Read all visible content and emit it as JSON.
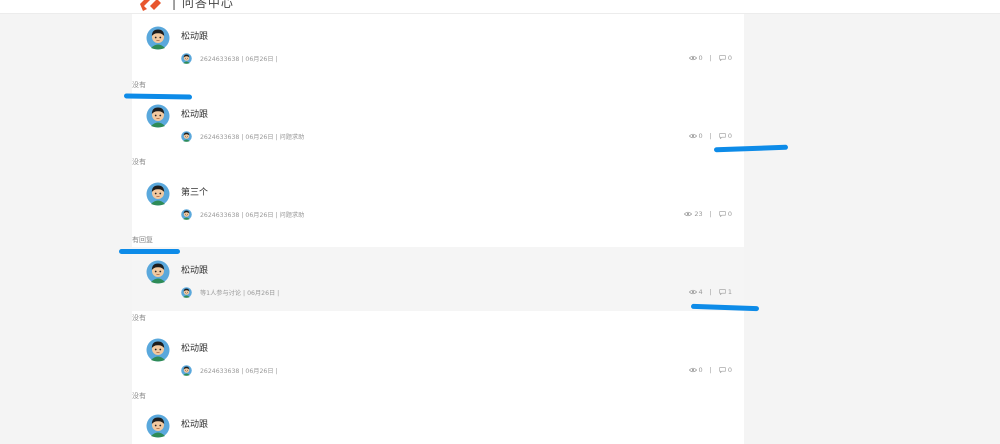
{
  "header": {
    "logo_text": "| 问答中心"
  },
  "posts": [
    {
      "title": "松动跟",
      "meta": "2624633638 | 06月26日 |",
      "views": "0",
      "replies": "0",
      "status": "没有"
    },
    {
      "title": "松动跟",
      "meta": "2624633638 | 06月26日 | 问题求助",
      "views": "0",
      "replies": "0",
      "status": "没有"
    },
    {
      "title": "第三个",
      "meta": "2624633638 | 06月26日 | 问题求助",
      "views": "23",
      "replies": "0",
      "status": "有回复"
    },
    {
      "title": "松动跟",
      "meta": "等1人参与讨论 | 06月26日 |",
      "views": "4",
      "replies": "1",
      "status": "没有"
    },
    {
      "title": "松动跟",
      "meta": "2624633638 | 06月26日 |",
      "views": "0",
      "replies": "0",
      "status": "没有"
    },
    {
      "title": "松动跟"
    }
  ],
  "colors": {
    "annotation_marker": "#0d8be8",
    "brand_logo": "#e8572f"
  }
}
